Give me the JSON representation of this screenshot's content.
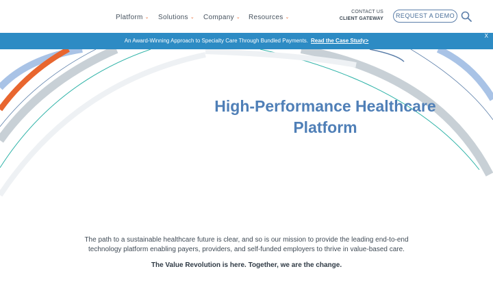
{
  "header": {
    "nav": [
      "Platform",
      "Solutions",
      "Company",
      "Resources"
    ],
    "contact_us": "CONTACT US",
    "client_gateway": "CLIENT GATEWAY",
    "demo_label": "REQUEST A DEMO",
    "search_icon": "search-icon"
  },
  "banner": {
    "text": "An Award-Winning Approach to Specialty Care Through Bundled Payments.",
    "link": "Read the Case Study>",
    "close": "X",
    "color": "#2d8bc4"
  },
  "hero": {
    "title_line1": "High-Performance Healthcare",
    "title_line2": "Platform",
    "title_color": "#4f7fb7"
  },
  "intro": {
    "description": "The path to a sustainable healthcare future is clear, and so is our mission to provide the leading end-to-end technology platform enabling payers, providers, and self-funded employers to thrive in value-based care.",
    "tagline": "The Value Revolution is here. Together, we are the change."
  },
  "colors": {
    "accent_orange": "#e8662f",
    "arc_gray": "#c8d0d6",
    "arc_blue": "#a9c3e6",
    "arc_teal": "#2fb3a8"
  }
}
